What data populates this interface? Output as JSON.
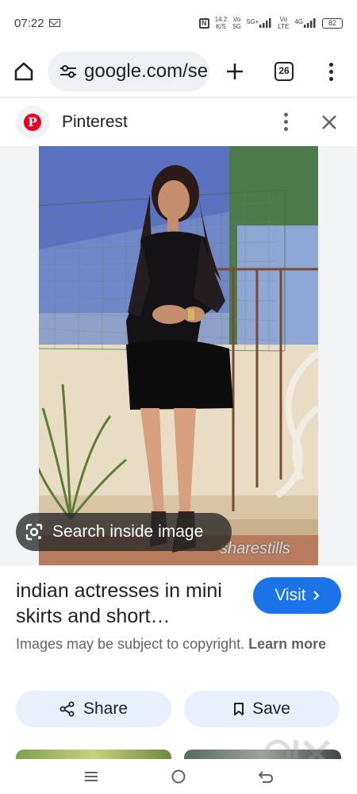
{
  "status_bar": {
    "time": "07:22",
    "speed_top": "14.2",
    "speed_bottom": "K/S",
    "sim1_top": "Vo",
    "sim1_bottom": "5G",
    "sim1_net": "5G+",
    "sim2_top": "Vo",
    "sim2_bottom": "LTE",
    "sim2_net": "4G",
    "battery": "82"
  },
  "browser": {
    "url": "google.com/se",
    "tab_count": "26"
  },
  "source": {
    "name": "Pinterest",
    "logo_letter": "P",
    "brand_color": "#e60023"
  },
  "image": {
    "search_inside_label": "Search inside image",
    "watermark_text": "sharestills"
  },
  "result": {
    "title": "indian actresses in mini skirts and short…",
    "visit_label": "Visit",
    "copyright_text": "Images may be subject to copyright.",
    "learn_more_label": "Learn more",
    "share_label": "Share",
    "save_label": "Save"
  },
  "colors": {
    "accent": "#1a73e8",
    "action_bg": "#e8f0fe"
  }
}
